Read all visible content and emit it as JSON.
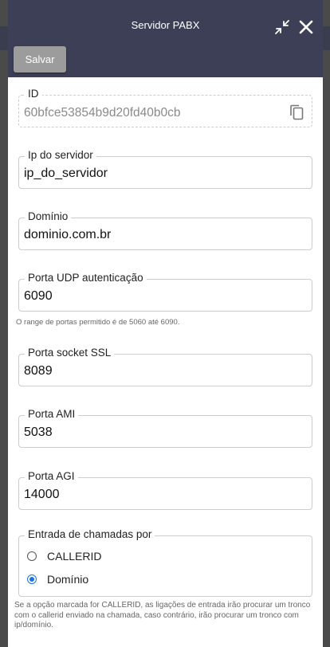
{
  "header": {
    "title": "Servidor PABX",
    "save_label": "Salvar",
    "minimize_icon": "minimize-arrows-icon",
    "close_icon": "close-icon"
  },
  "fields": {
    "id": {
      "label": "ID",
      "value": "60bfce53854b9d20fd40b0cb"
    },
    "ip": {
      "label": "Ip do servidor",
      "value": "ip_do_servidor"
    },
    "domain": {
      "label": "Domínio",
      "value": "dominio.com.br"
    },
    "udp_port": {
      "label": "Porta UDP autenticação",
      "value": "6090",
      "helper": "O range de portas permitido é de 5060 até 6090."
    },
    "ssl_port": {
      "label": "Porta socket SSL",
      "value": "8089"
    },
    "ami_port": {
      "label": "Porta AMI",
      "value": "5038"
    },
    "agi_port": {
      "label": "Porta AGI",
      "value": "14000"
    }
  },
  "incoming": {
    "label": "Entrada de chamadas por",
    "options": [
      {
        "label": "CALLERID",
        "checked": false
      },
      {
        "label": "Domínio",
        "checked": true
      }
    ],
    "footnote": "Se a opção marcada for CALLERID, as ligações de entrada irão procurar um tronco com o callerid enviado na chamada, caso contrário, irão procurar um tronco com ip/domínio."
  },
  "colors": {
    "header_bg": "#3c3f56",
    "save_button_bg": "#9c9c9c",
    "radio_accent": "#1a73e8"
  }
}
